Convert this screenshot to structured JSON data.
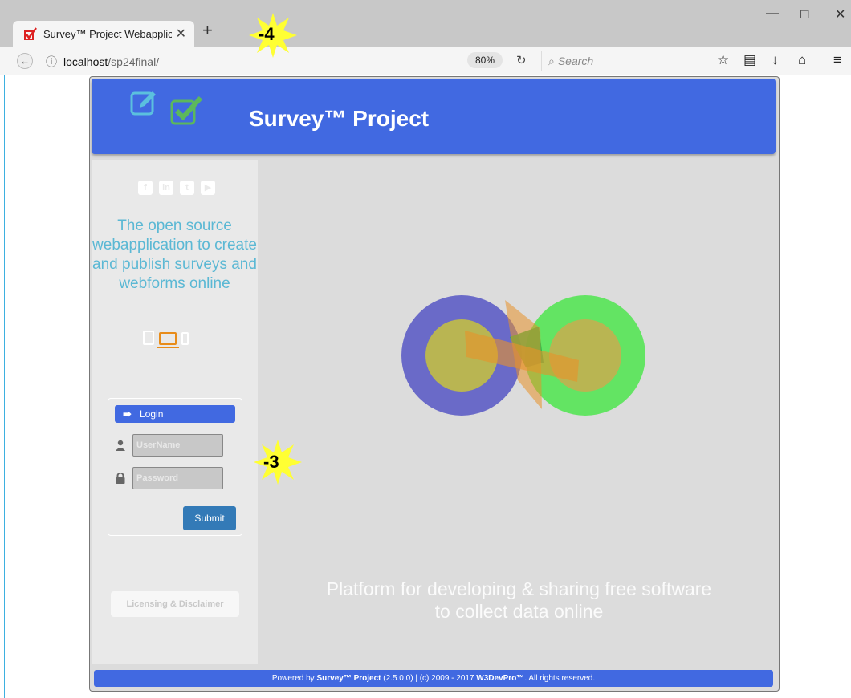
{
  "browser": {
    "tab_title": "Survey™ Project Webapplica",
    "tab_close": "✕",
    "new_tab": "+",
    "url_host": "localhost",
    "url_path": "/sp24final/",
    "zoom": "80%",
    "search_placeholder": "Search"
  },
  "header": {
    "title": "Survey™ Project"
  },
  "sidebar": {
    "tagline": "The open source webapplication to create and publish surveys and webforms online",
    "login_heading": "Login",
    "username_placeholder": "UserName",
    "password_placeholder": "Password",
    "submit_label": "Submit",
    "licensing_label": "Licensing & Disclaimer"
  },
  "content": {
    "platform_line1": "Platform for developing & sharing free software",
    "platform_line2": "to collect data online"
  },
  "footer": {
    "prefix": "Powered by ",
    "product": "Survey™ Project",
    "version_text": " (2.5.0.0) | (c) 2009 - 2017 ",
    "company": "W3DevPro™",
    "suffix": ". All rights reserved."
  },
  "annotations": {
    "top_badge": "-4",
    "mid_badge": "-3"
  },
  "colors": {
    "header_blue": "#4169e1",
    "tagline_teal": "#5bb8d4",
    "laptop_orange": "#e88c1a",
    "submit_blue": "#337ab7"
  }
}
